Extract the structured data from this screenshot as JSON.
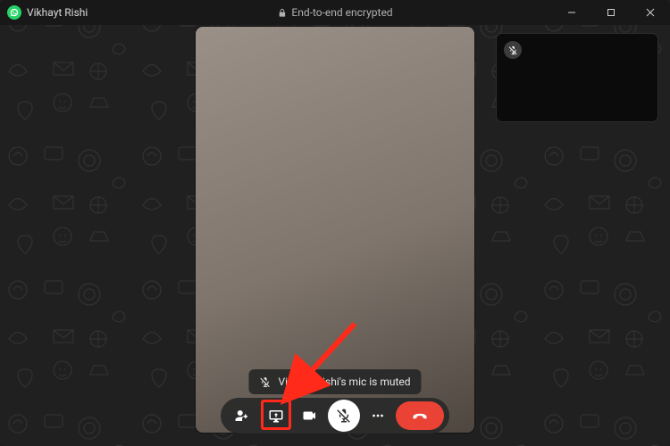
{
  "titlebar": {
    "contact_name": "Vikhayt Rishi",
    "encryption_label": "End-to-end encrypted"
  },
  "toast": {
    "text": "Vikhayt Rishi's mic is muted"
  },
  "controls": {
    "add_participant": "add-participant",
    "share_screen": "share-screen",
    "toggle_video": "toggle-video",
    "toggle_mic": "toggle-mic",
    "more_options": "more-options",
    "end_call": "end-call"
  },
  "colors": {
    "end_call": "#ea4335",
    "brand": "#25d366",
    "highlight": "#ff2a1a"
  }
}
